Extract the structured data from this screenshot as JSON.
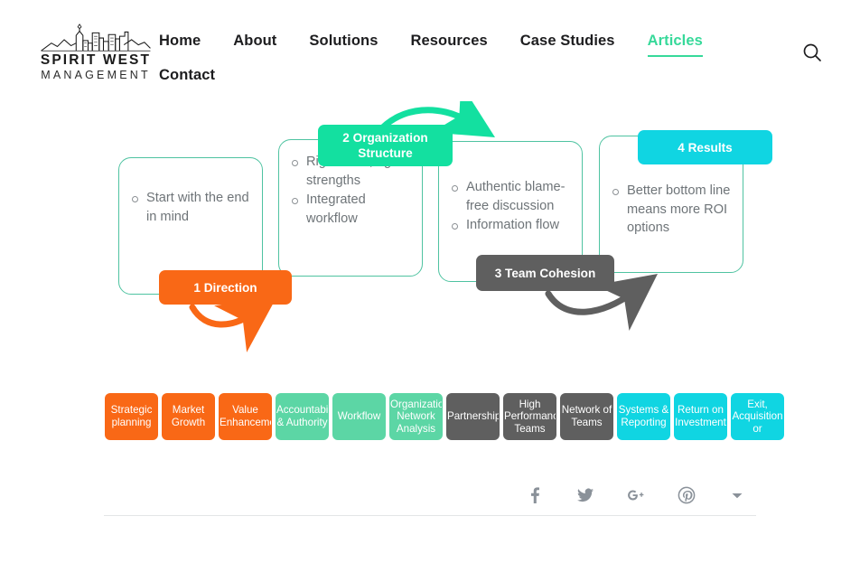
{
  "brand": {
    "name": "SPIRIT WEST",
    "subtitle": "MANAGEMENT",
    "logo_icon": "city-skyline-icon"
  },
  "nav": {
    "items": [
      {
        "label": "Home",
        "active": false
      },
      {
        "label": "About",
        "active": false
      },
      {
        "label": "Solutions",
        "active": false
      },
      {
        "label": "Resources",
        "active": false
      },
      {
        "label": "Case Studies",
        "active": false
      },
      {
        "label": "Articles",
        "active": true
      },
      {
        "label": "Contact",
        "active": false
      }
    ],
    "search_icon": "search-icon",
    "active_color": "#37d99a"
  },
  "diagram": {
    "cards": [
      {
        "id": "direction",
        "label": "1 Direction",
        "label_color": "#f96816",
        "bullets": [
          "Start with the end in mind"
        ]
      },
      {
        "id": "organization-structure",
        "label": "2 Organization Structure",
        "label_color": "#13e0a0",
        "bullets": [
          "Right roles, right strengths",
          "Integrated workflow"
        ]
      },
      {
        "id": "team-cohesion",
        "label": "3 Team Cohesion",
        "label_color": "#5f5f5f",
        "bullets": [
          "Authentic blame-free discussion",
          "Information flow"
        ]
      },
      {
        "id": "results",
        "label": "4 Results",
        "label_color": "#10d5e2",
        "bullets": [
          "Better bottom line means more ROI options"
        ]
      }
    ],
    "card_border_color": "#4fc3a1",
    "arrows": [
      {
        "name": "orange-arrow",
        "color": "#f96816"
      },
      {
        "name": "green-arrow",
        "color": "#13e0a0"
      },
      {
        "name": "gray-arrow",
        "color": "#5f5f5f"
      }
    ]
  },
  "tags": {
    "colors": {
      "orange": "#f96816",
      "green": "#5cd6a5",
      "gray": "#5f5f5f",
      "cyan": "#10d5e2"
    },
    "items": [
      {
        "label": "Strategic planning",
        "color": "#f96816"
      },
      {
        "label": "Market Growth",
        "color": "#f96816"
      },
      {
        "label": "Value Enhancement",
        "color": "#f96816"
      },
      {
        "label": "Accountability & Authority",
        "color": "#5cd6a5"
      },
      {
        "label": "Workflow",
        "color": "#5cd6a5"
      },
      {
        "label": "Organizational Network Analysis",
        "color": "#5cd6a5"
      },
      {
        "label": "Partnership",
        "color": "#5f5f5f"
      },
      {
        "label": "High Performance Teams",
        "color": "#5f5f5f"
      },
      {
        "label": "Network of Teams",
        "color": "#5f5f5f"
      },
      {
        "label": "Systems & Reporting",
        "color": "#10d5e2"
      },
      {
        "label": "Return on Investment",
        "color": "#10d5e2"
      },
      {
        "label": "Exit, Acquisition or",
        "color": "#10d5e2"
      }
    ]
  },
  "footer": {
    "social": [
      {
        "name": "facebook-icon",
        "glyph": "f"
      },
      {
        "name": "twitter-icon",
        "glyph": "t"
      },
      {
        "name": "google-plus-icon",
        "glyph": "G+"
      },
      {
        "name": "pinterest-icon",
        "glyph": "P"
      },
      {
        "name": "more-share-chevron-icon",
        "glyph": "caret"
      }
    ]
  }
}
